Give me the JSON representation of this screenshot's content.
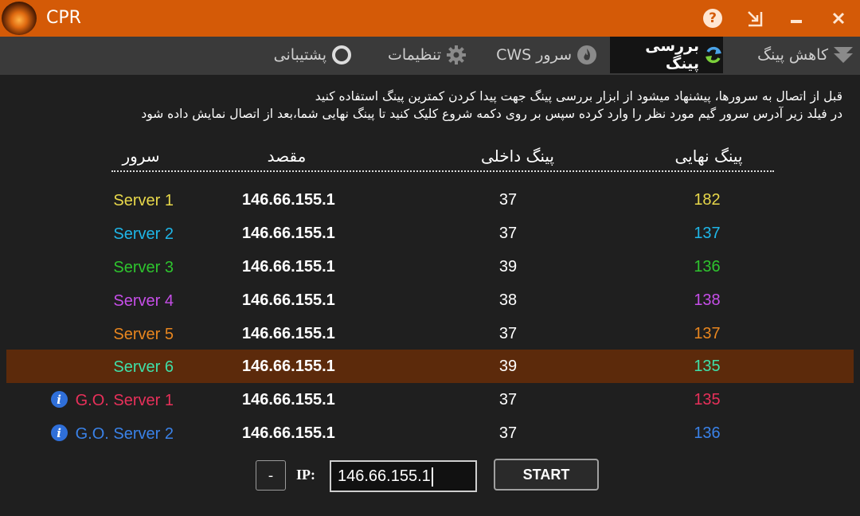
{
  "window": {
    "title": "CPR"
  },
  "tabs": [
    {
      "label": "کاهش پینگ",
      "icon": "funnel-icon"
    },
    {
      "label": "بررسی پینگ",
      "icon": "refresh-icon",
      "active": true
    },
    {
      "label": "سرور CWS",
      "icon": "flame-icon"
    },
    {
      "label": "تنظیمات",
      "icon": "gear-icon"
    },
    {
      "label": "پشتیبانی",
      "icon": "ring-icon"
    }
  ],
  "description": {
    "line1": "قبل از اتصال به سرورها، پیشنهاد میشود از ابزار بررسی پینگ جهت پیدا کردن کمترین پینگ استفاده کنید",
    "line2": "در فیلد زیر آدرس سرور گیم مورد نظر را وارد کرده سپس بر روی دکمه شروع کلیک کنید تا پینگ نهایی شما،بعد از اتصال نمایش داده شود"
  },
  "table": {
    "headers": {
      "server": "سرور",
      "destination": "مقصد",
      "internal_ping": "پینگ داخلی",
      "final_ping": "پینگ نهایی"
    },
    "rows": [
      {
        "name": "Server 1",
        "ip": "146.66.155.1",
        "internal": "37",
        "final": "182",
        "color": "#e8d84a",
        "info": false,
        "selected": false
      },
      {
        "name": "Server 2",
        "ip": "146.66.155.1",
        "internal": "37",
        "final": "137",
        "color": "#1fb6e8",
        "info": false,
        "selected": false
      },
      {
        "name": "Server 3",
        "ip": "146.66.155.1",
        "internal": "39",
        "final": "136",
        "color": "#2ec42e",
        "info": false,
        "selected": false
      },
      {
        "name": "Server 4",
        "ip": "146.66.155.1",
        "internal": "38",
        "final": "138",
        "color": "#c64ee8",
        "info": false,
        "selected": false
      },
      {
        "name": "Server 5",
        "ip": "146.66.155.1",
        "internal": "37",
        "final": "137",
        "color": "#e8861f",
        "info": false,
        "selected": false
      },
      {
        "name": "Server 6",
        "ip": "146.66.155.1",
        "internal": "39",
        "final": "135",
        "color": "#3fe0a8",
        "info": false,
        "selected": true
      },
      {
        "name": "G.O. Server 1",
        "ip": "146.66.155.1",
        "internal": "37",
        "final": "135",
        "color": "#e8305a",
        "info": true,
        "selected": false
      },
      {
        "name": "G.O. Server 2",
        "ip": "146.66.155.1",
        "internal": "37",
        "final": "136",
        "color": "#3a82e8",
        "info": true,
        "selected": false
      }
    ]
  },
  "controls": {
    "minus_label": "-",
    "ip_label": "IP:",
    "ip_value": "146.66.155.1",
    "start_label": "START"
  },
  "colors": {
    "titlebar": "#d45a07",
    "selected_row": "#5c2a0b",
    "background": "#1f1f1f"
  }
}
